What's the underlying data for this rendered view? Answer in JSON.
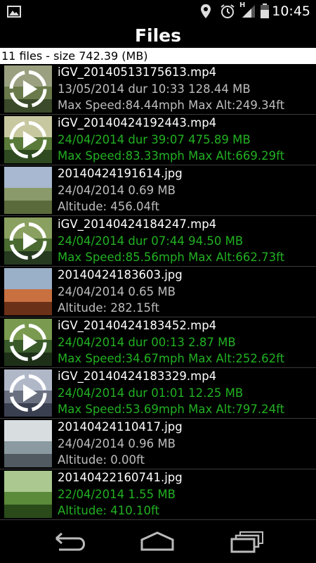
{
  "status_bar": {
    "time": "10:45",
    "icons": [
      "image-notification-icon",
      "location-icon",
      "alarm-icon",
      "signal-icon",
      "battery-icon"
    ],
    "network_label": "H"
  },
  "header": {
    "title": "Files"
  },
  "summary": "11 files - size 742.39 (MB)",
  "files": [
    {
      "name": "iGV_20140513175613.mp4",
      "line2": "13/05/2014 dur 10:33  128.44 MB",
      "line3": "Max Speed:84.44mph  Max Alt:249.34ft",
      "color": "gray",
      "video": true
    },
    {
      "name": "iGV_20140424192443.mp4",
      "line2": "24/04/2014 dur 39:07  475.89 MB",
      "line3": "Max Speed:83.33mph  Max Alt:669.29ft",
      "color": "green",
      "video": true
    },
    {
      "name": "20140424191614.jpg",
      "line2": "24/04/2014  0.69 MB",
      "line3": "Altitude: 456.04ft",
      "color": "gray",
      "video": false
    },
    {
      "name": "iGV_20140424184247.mp4",
      "line2": "24/04/2014 dur 07:44  94.50 MB",
      "line3": "Max Speed:85.56mph  Max Alt:662.73ft",
      "color": "green",
      "video": true
    },
    {
      "name": "20140424183603.jpg",
      "line2": "24/04/2014  0.65 MB",
      "line3": "Altitude: 282.15ft",
      "color": "gray",
      "video": false
    },
    {
      "name": "iGV_20140424183452.mp4",
      "line2": "24/04/2014 dur 00:13  2.87 MB",
      "line3": "Max Speed:34.67mph  Max Alt:252.62ft",
      "color": "green",
      "video": true
    },
    {
      "name": "iGV_20140424183329.mp4",
      "line2": "24/04/2014 dur 01:01  12.25 MB",
      "line3": "Max Speed:53.69mph  Max Alt:797.24ft",
      "color": "green",
      "video": true
    },
    {
      "name": "20140424110417.jpg",
      "line2": "24/04/2014  0.96 MB",
      "line3": "Altitude: 0.00ft",
      "color": "gray",
      "video": false
    },
    {
      "name": "20140422160741.jpg",
      "line2": "22/04/2014  1.55 MB",
      "line3": "Altitude: 410.10ft",
      "color": "green",
      "video": false
    }
  ],
  "nav_bar": {
    "icons": [
      "back-icon",
      "home-icon",
      "recent-apps-icon"
    ]
  },
  "colors": {
    "green": "#22b022",
    "gray": "#bdbdbd",
    "background": "#000000",
    "summary_bg": "#ffffff"
  }
}
